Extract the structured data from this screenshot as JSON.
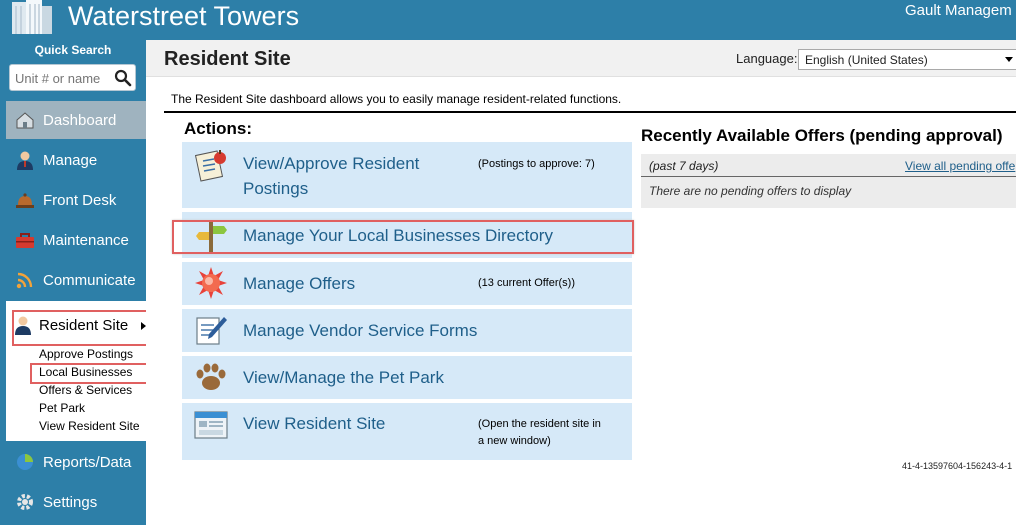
{
  "header": {
    "title": "Waterstreet Towers",
    "company": "Gault Managem"
  },
  "sidebar": {
    "quick_search_label": "Quick Search",
    "quick_search_placeholder": "Unit # or name",
    "nav": [
      {
        "label": "Dashboard",
        "icon": "dashboard-icon"
      },
      {
        "label": "Manage",
        "icon": "manager-icon"
      },
      {
        "label": "Front Desk",
        "icon": "front-desk-bell-icon"
      },
      {
        "label": "Maintenance",
        "icon": "toolbox-icon"
      },
      {
        "label": "Communicate",
        "icon": "wifi-icon"
      },
      {
        "label": "Resident Site",
        "icon": "resident-icon"
      },
      {
        "label": "Reports/Data",
        "icon": "pie-chart-icon"
      },
      {
        "label": "Settings",
        "icon": "gear-icon"
      }
    ],
    "resident_links": [
      "Approve Postings",
      "Local Businesses",
      "Offers & Services",
      "Pet Park",
      "View Resident Site"
    ]
  },
  "main": {
    "page_title": "Resident Site",
    "language_label": "Language:",
    "language_value": "English (United States)",
    "intro": "The Resident Site dashboard allows you to easily manage resident-related functions.",
    "actions_heading": "Actions:",
    "actions": [
      {
        "label_lines": [
          "View/Approve Resident",
          "Postings"
        ],
        "note_lines": [
          "(Postings to approve: 7)"
        ],
        "icon": "clipboard-apple-icon"
      },
      {
        "label_lines": [
          "Manage Your Local Businesses Directory"
        ],
        "note_lines": [],
        "icon": "signpost-icon"
      },
      {
        "label_lines": [
          "Manage Offers"
        ],
        "note_lines": [
          "(13 current Offer(s))"
        ],
        "icon": "starburst-icon"
      },
      {
        "label_lines": [
          "Manage Vendor Service Forms"
        ],
        "note_lines": [],
        "icon": "form-pencil-icon"
      },
      {
        "label_lines": [
          "View/Manage the Pet Park"
        ],
        "note_lines": [],
        "icon": "paw-icon"
      },
      {
        "label_lines": [
          "View Resident Site"
        ],
        "note_lines": [
          "(Open the resident site in",
          "a new window)"
        ],
        "icon": "browser-window-icon"
      }
    ],
    "offers": {
      "heading": "Recently Available Offers (pending approval)",
      "period": "(past 7 days)",
      "view_all_link": "View all pending offe",
      "empty_message": "There are no pending offers to display"
    },
    "build_id": "41-4-13597604-156243-4-1"
  },
  "colors": {
    "brand_blue": "#2d7fa8",
    "action_bg": "#d6e9f8",
    "link": "#1f5f8a",
    "highlight": "#e06060"
  }
}
